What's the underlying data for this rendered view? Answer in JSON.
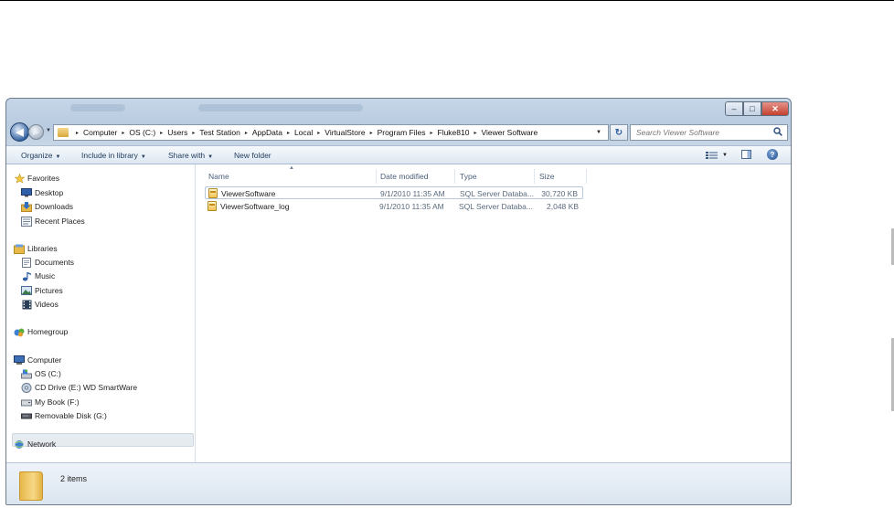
{
  "window": {
    "controls": {
      "minimize": "–",
      "maximize": "□",
      "close": "✕"
    }
  },
  "nav": {
    "back_glyph": "◀",
    "forward_glyph": "▶"
  },
  "address": {
    "crumbs": [
      "Computer",
      "OS (C:)",
      "Users",
      "Test Station",
      "AppData",
      "Local",
      "VirtualStore",
      "Program Files",
      "Fluke810",
      "Viewer Software"
    ],
    "separator": "▸",
    "refresh_glyph": "↻"
  },
  "search": {
    "placeholder": "Search Viewer Software",
    "icon": "search-icon"
  },
  "toolbar": {
    "organize": "Organize",
    "include_in_library": "Include in library",
    "share_with": "Share with",
    "new_folder": "New folder",
    "dropdown_glyph": "▼",
    "help_glyph": "?"
  },
  "sidebar": {
    "groups": [
      {
        "label": "Favorites",
        "icon": "star-icon",
        "items": [
          {
            "label": "Desktop",
            "icon": "desktop-icon"
          },
          {
            "label": "Downloads",
            "icon": "downloads-icon"
          },
          {
            "label": "Recent Places",
            "icon": "recent-places-icon"
          }
        ]
      },
      {
        "label": "Libraries",
        "icon": "libraries-icon",
        "items": [
          {
            "label": "Documents",
            "icon": "documents-icon"
          },
          {
            "label": "Music",
            "icon": "music-icon"
          },
          {
            "label": "Pictures",
            "icon": "pictures-icon"
          },
          {
            "label": "Videos",
            "icon": "videos-icon"
          }
        ]
      },
      {
        "label": "Homegroup",
        "icon": "homegroup-icon",
        "items": []
      },
      {
        "label": "Computer",
        "icon": "computer-icon",
        "items": [
          {
            "label": "OS (C:)",
            "icon": "hard-drive-icon",
            "selected": true
          },
          {
            "label": "CD Drive (E:) WD SmartWare",
            "icon": "cd-drive-icon"
          },
          {
            "label": "My Book (F:)",
            "icon": "external-drive-icon"
          },
          {
            "label": "Removable Disk (G:)",
            "icon": "removable-disk-icon"
          }
        ]
      },
      {
        "label": "Network",
        "icon": "network-icon",
        "items": []
      }
    ]
  },
  "files": {
    "columns": [
      "Name",
      "Date modified",
      "Type",
      "Size"
    ],
    "sort_glyph": "▲",
    "rows": [
      {
        "name": "ViewerSoftware",
        "date": "9/1/2010 11:35 AM",
        "type": "SQL Server Databa...",
        "size": "30,720 KB"
      },
      {
        "name": "ViewerSoftware_log",
        "date": "9/1/2010 11:35 AM",
        "type": "SQL Server Databa...",
        "size": "2,048 KB"
      }
    ]
  },
  "status": {
    "count": "2 items"
  },
  "colors": {
    "accent": "#1e395b",
    "frame": "#c6d6e8",
    "close": "#c4422f"
  }
}
